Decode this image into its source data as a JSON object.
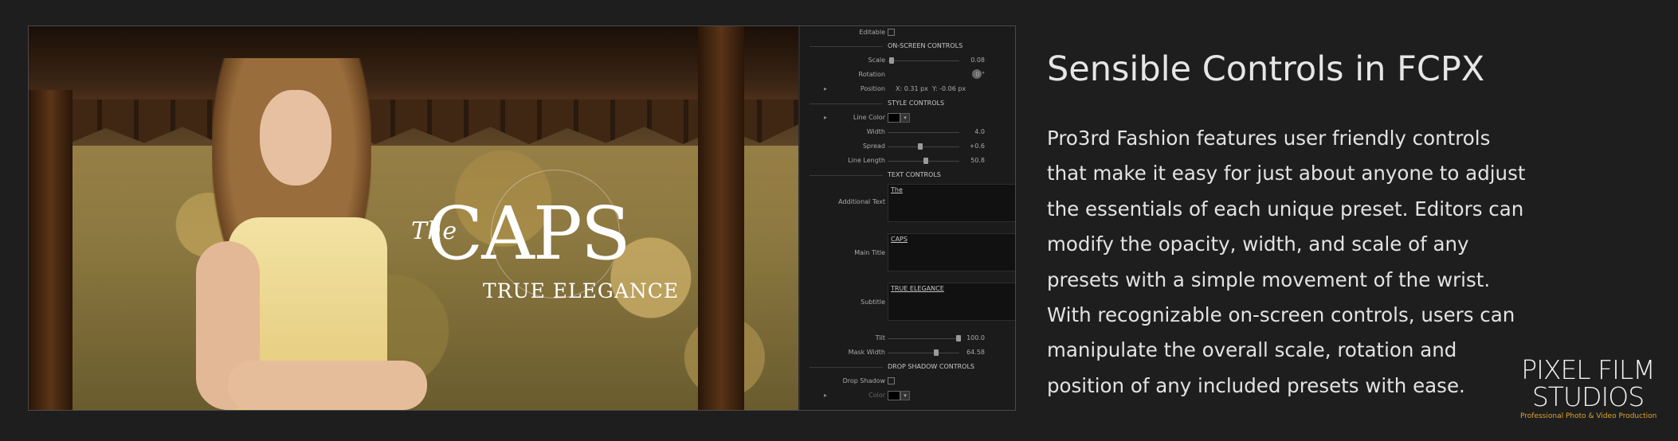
{
  "video": {
    "logo_the": "The",
    "logo_main": "CAPS",
    "logo_sub": "TRUE ELEGANCE"
  },
  "inspector": {
    "editable": "Editable",
    "onscreen_header": "ON-SCREEN CONTROLS",
    "scale_label": "Scale",
    "scale_value": "0.08",
    "rotation_label": "Rotation",
    "rotation_value": "0 °",
    "position_label": "Position",
    "position_x_label": "X:",
    "position_x_value": "0.31 px",
    "position_y_label": "Y:",
    "position_y_value": "-0.06 px",
    "style_header": "STYLE CONTROLS",
    "line_color_label": "Line Color",
    "width_label": "Width",
    "width_value": "4.0",
    "spread_label": "Spread",
    "spread_value": "+0.6",
    "line_length_label": "Line Length",
    "line_length_value": "50.8",
    "text_header": "TEXT CONTROLS",
    "additional_text_label": "Additional Text",
    "additional_text_value": "The",
    "main_title_label": "Main Title",
    "main_title_value": "CAPS",
    "subtitle_label": "Subtitle",
    "subtitle_value": "TRUE ELEGANCE",
    "tilt_label": "Tilt",
    "tilt_value": "100.0",
    "mask_width_label": "Mask Width",
    "mask_width_value": "64.58",
    "shadow_header": "DROP SHADOW CONTROLS",
    "drop_shadow_label": "Drop Shadow",
    "color_label": "Color"
  },
  "content": {
    "title": "Sensible Controls in FCPX",
    "lines": [
      "Pro3rd Fashion features user friendly controls",
      "that make it easy for just about anyone to adjust",
      "the essentials of each unique preset. Editors can",
      "modify the opacity, width, and scale of any",
      "presets with a simple movement of the wrist.",
      "With recognizable on-screen controls, users can",
      "manipulate the overall scale, rotation and",
      "position of any included presets with ease."
    ]
  },
  "brand": {
    "line1": "PIXEL FILM",
    "line2": "STUDIOS",
    "tagline": "Professional Photo & Video Production"
  },
  "colors": {
    "background": "#1e1e1e",
    "brand_tagline": "#d9a531"
  }
}
